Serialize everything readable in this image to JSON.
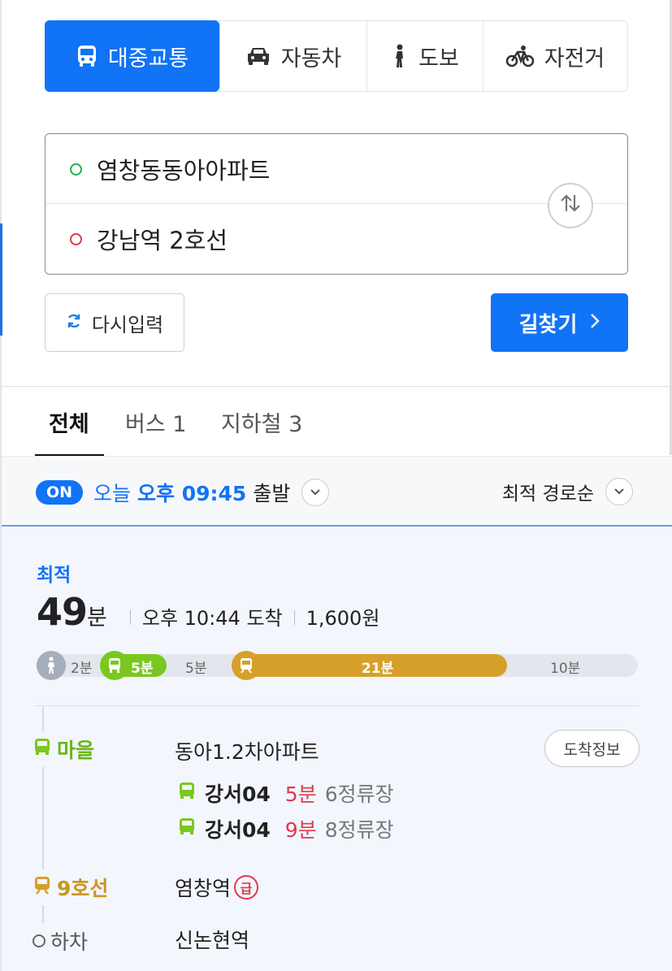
{
  "modes": [
    {
      "label": "대중교통",
      "icon": "bus-icon",
      "active": true
    },
    {
      "label": "자동차",
      "icon": "car-icon",
      "active": false
    },
    {
      "label": "도보",
      "icon": "walk-icon",
      "active": false
    },
    {
      "label": "자전거",
      "icon": "bicycle-icon",
      "active": false
    }
  ],
  "route": {
    "origin": "염창동동아아파트",
    "destination": "강남역 2호선"
  },
  "actions": {
    "reset_label": "다시입력",
    "search_label": "길찾기"
  },
  "result_tabs": [
    {
      "label": "전체",
      "active": true
    },
    {
      "label": "버스 1",
      "active": false
    },
    {
      "label": "지하철 3",
      "active": false
    }
  ],
  "filter": {
    "on_badge": "ON",
    "day": "오늘",
    "time": "오후 09:45",
    "depart_suffix": "출발",
    "sort_label": "최적 경로순"
  },
  "best": {
    "label": "최적",
    "minutes": "49",
    "minutes_unit": "분",
    "arrival": "오후 10:44 도착",
    "fare": "1,600원"
  },
  "timeline": {
    "walk1": "2분",
    "bus": "5분",
    "wait": "5분",
    "subway": "21분",
    "walk2": "10분"
  },
  "steps": {
    "bus_type": "마을",
    "bus_stop": "동아1.2차아파트",
    "arrive_info": "도착정보",
    "bus_lines": [
      {
        "number": "강서04",
        "minutes": "5분",
        "stops": "6정류장"
      },
      {
        "number": "강서04",
        "minutes": "9분",
        "stops": "8정류장"
      }
    ],
    "subway_type": "9호선",
    "subway_stop": "염창역",
    "express_badge": "급",
    "off_type": "하차",
    "off_stop": "신논현역"
  },
  "colors": {
    "accent": "#1173f5",
    "bus_green": "#7ac81f",
    "subway_gold": "#d6a02b",
    "red": "#e0394c"
  }
}
